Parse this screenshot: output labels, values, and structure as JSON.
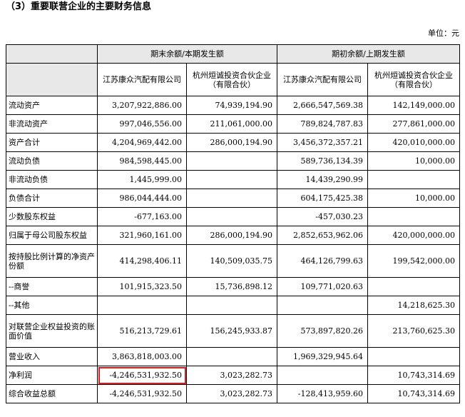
{
  "heading": "（3）重要联营企业的主要财务信息",
  "unit_label": "单位：元",
  "header": {
    "period_current": "期末余额/本期发生额",
    "period_prior": "期初余额/上期发生额",
    "company_a": "江苏康众汽配有限公司",
    "company_b_line1": "杭州烜诚投资合伙企业",
    "company_b_line2": "（有限合伙）"
  },
  "rows": [
    {
      "label": "流动资产",
      "c1": "3,207,922,886.00",
      "c2": "74,939,194.90",
      "p1": "2,666,547,569.38",
      "p2": "142,149,000.00"
    },
    {
      "label": "非流动资产",
      "c1": "997,046,556.00",
      "c2": "211,061,000.00",
      "p1": "789,824,787.83",
      "p2": "277,861,000.00"
    },
    {
      "label": "资产合计",
      "c1": "4,204,969,442.00",
      "c2": "286,000,194.90",
      "p1": "3,456,372,357.21",
      "p2": "420,010,000.00"
    },
    {
      "label": "流动负债",
      "c1": "984,598,445.00",
      "c2": "",
      "p1": "589,736,134.39",
      "p2": "10,000.00"
    },
    {
      "label": "非流动负债",
      "c1": "1,445,999.00",
      "c2": "",
      "p1": "14,439,290.99",
      "p2": ""
    },
    {
      "label": "负债合计",
      "c1": "986,044,444.00",
      "c2": "",
      "p1": "604,175,425.38",
      "p2": "10,000.00"
    },
    {
      "label": "少数股东权益",
      "c1": "-677,163.00",
      "c2": "",
      "p1": "-457,030.23",
      "p2": ""
    },
    {
      "label": "归属于母公司股东权益",
      "c1": "321,960,161.00",
      "c2": "286,000,194.90",
      "p1": "2,852,653,962.06",
      "p2": "420,000,000.00"
    },
    {
      "label": "按持股比例计算的净资产份额",
      "c1": "414,298,406.11",
      "c2": "140,509,035.75",
      "p1": "464,126,799.63",
      "p2": "199,542,000.00"
    },
    {
      "label": "--商誉",
      "c1": "101,915,323.50",
      "c2": "15,736,898.12",
      "p1": "109,771,020.63",
      "p2": ""
    },
    {
      "label": "--其他",
      "c1": "",
      "c2": "",
      "p1": "",
      "p2": "14,218,625.30"
    },
    {
      "label": "对联营企业权益投资的账面价值",
      "c1": "516,213,729.61",
      "c2": "156,245,933.87",
      "p1": "573,897,820.26",
      "p2": "213,760,625.30"
    },
    {
      "label": "营业收入",
      "c1": "3,863,818,003.00",
      "c2": "",
      "p1": "1,969,329,945.64",
      "p2": ""
    },
    {
      "label": "净利润",
      "c1": "-4,246,531,932.50",
      "c2": "3,023,282.73",
      "p1": "",
      "p2": "10,743,314.69"
    },
    {
      "label": "综合收益总额",
      "c1": "-4,246,531,932.50",
      "c2": "3,023,282.73",
      "p1": "-128,413,959.60",
      "p2": "10,743,314.69"
    }
  ]
}
